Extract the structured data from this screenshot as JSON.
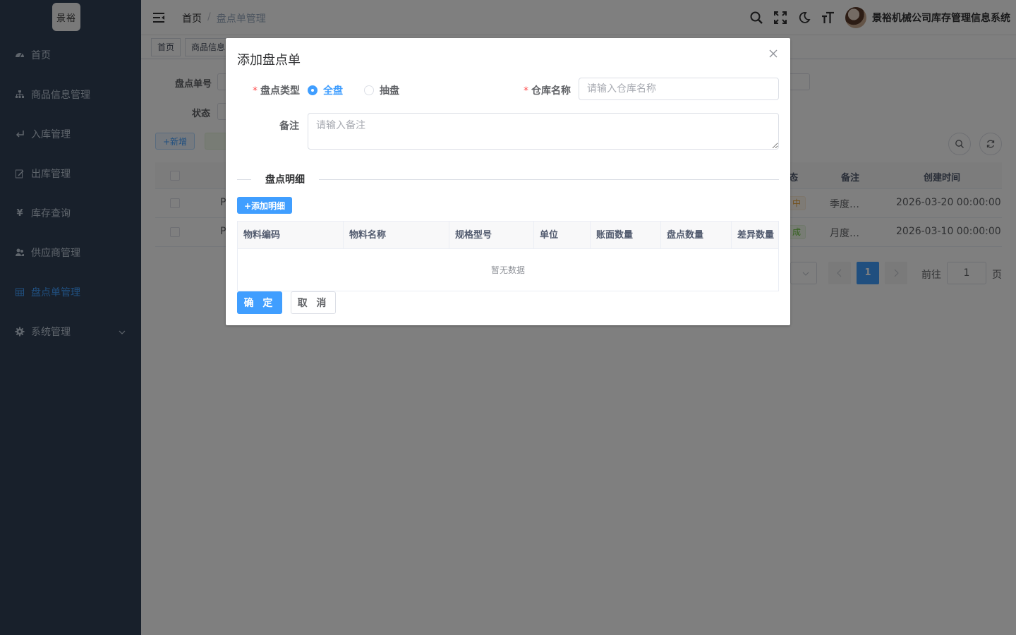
{
  "logo": {
    "text": "景裕"
  },
  "sidebar": {
    "items": [
      {
        "label": "首页",
        "icon": "dashboard-icon"
      },
      {
        "label": "商品信息管理",
        "icon": "tree-icon"
      },
      {
        "label": "入库管理",
        "icon": "enter-icon"
      },
      {
        "label": "出库管理",
        "icon": "edit-icon"
      },
      {
        "label": "库存查询",
        "icon": "money-icon"
      },
      {
        "label": "供应商管理",
        "icon": "peoples-icon"
      },
      {
        "label": "盘点单管理",
        "icon": "table-icon",
        "active": true
      },
      {
        "label": "系统管理",
        "icon": "gear-icon"
      }
    ]
  },
  "navbar": {
    "breadcrumb": [
      "首页",
      "盘点单管理"
    ],
    "sep": "/",
    "system_name": "景裕机械公司库存管理信息系统"
  },
  "tags": [
    "首页",
    "商品信息"
  ],
  "query": {
    "label_no": "盘点单号",
    "label_status": "状态",
    "btn_add": "+新增"
  },
  "list": {
    "headers": {
      "status": "态",
      "remark": "备注",
      "created": "创建时间"
    },
    "rows": [
      {
        "no": "P",
        "status": "中",
        "remark": "季度…",
        "created": "2026-03-20 00:00:00"
      },
      {
        "no": "P",
        "status": "成",
        "remark": "月度…",
        "created": "2026-03-10 00:00:00"
      }
    ],
    "pager": {
      "page": "1",
      "goto": "前往",
      "goto_value": "1",
      "page_suffix": "页"
    }
  },
  "dialog": {
    "title": "添加盘点单",
    "type_label": "盘点类型",
    "type_options": [
      "全盘",
      "抽盘"
    ],
    "type_selected": "全盘",
    "warehouse_label": "仓库名称",
    "warehouse_placeholder": "请输入仓库名称",
    "remark_label": "备注",
    "remark_placeholder": "请输入备注",
    "detail_title": "盘点明细",
    "add_detail_btn": "+添加明细",
    "detail_headers": [
      "物料编码",
      "物料名称",
      "规格型号",
      "单位",
      "账面数量",
      "盘点数量",
      "差异数量"
    ],
    "empty_text": "暂无数据",
    "confirm": "确 定",
    "cancel": "取 消"
  },
  "colors": {
    "primary": "#409eff",
    "sidebar": "#304156",
    "required": "#ff4949"
  }
}
